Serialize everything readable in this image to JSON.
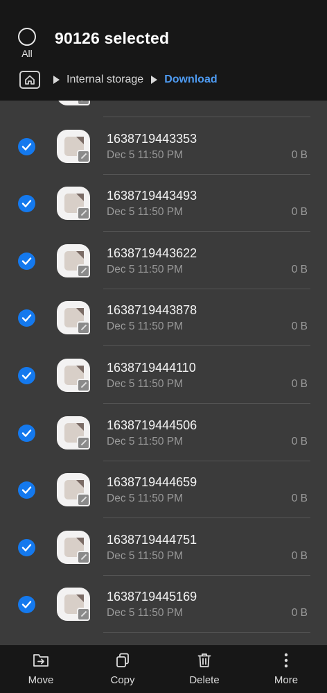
{
  "header": {
    "all_label": "All",
    "title": "90126 selected",
    "breadcrumb": {
      "root": "Internal storage",
      "current": "Download"
    }
  },
  "files": [
    {
      "name": "",
      "date": "",
      "size": "",
      "selected": true
    },
    {
      "name": "1638719443353",
      "date": "Dec 5 11:50 PM",
      "size": "0 B",
      "selected": true
    },
    {
      "name": "1638719443493",
      "date": "Dec 5 11:50 PM",
      "size": "0 B",
      "selected": true
    },
    {
      "name": "1638719443622",
      "date": "Dec 5 11:50 PM",
      "size": "0 B",
      "selected": true
    },
    {
      "name": "1638719443878",
      "date": "Dec 5 11:50 PM",
      "size": "0 B",
      "selected": true
    },
    {
      "name": "1638719444110",
      "date": "Dec 5 11:50 PM",
      "size": "0 B",
      "selected": true
    },
    {
      "name": "1638719444506",
      "date": "Dec 5 11:50 PM",
      "size": "0 B",
      "selected": true
    },
    {
      "name": "1638719444659",
      "date": "Dec 5 11:50 PM",
      "size": "0 B",
      "selected": true
    },
    {
      "name": "1638719444751",
      "date": "Dec 5 11:50 PM",
      "size": "0 B",
      "selected": true
    },
    {
      "name": "1638719445169",
      "date": "Dec 5 11:50 PM",
      "size": "0 B",
      "selected": true
    }
  ],
  "toolbar": {
    "move": "Move",
    "copy": "Copy",
    "delete": "Delete",
    "more": "More"
  },
  "colors": {
    "accent": "#4e9bf2",
    "check": "#1479ee",
    "background": "#3b3b3b",
    "header": "#171717"
  },
  "icons": {
    "select_all": "circle-outline-icon",
    "home": "home-folder-icon",
    "file": "document-file-icon",
    "check": "checkmark-icon",
    "move": "move-folder-icon",
    "copy": "copy-icon",
    "delete": "trash-icon",
    "more": "more-vertical-icon"
  }
}
